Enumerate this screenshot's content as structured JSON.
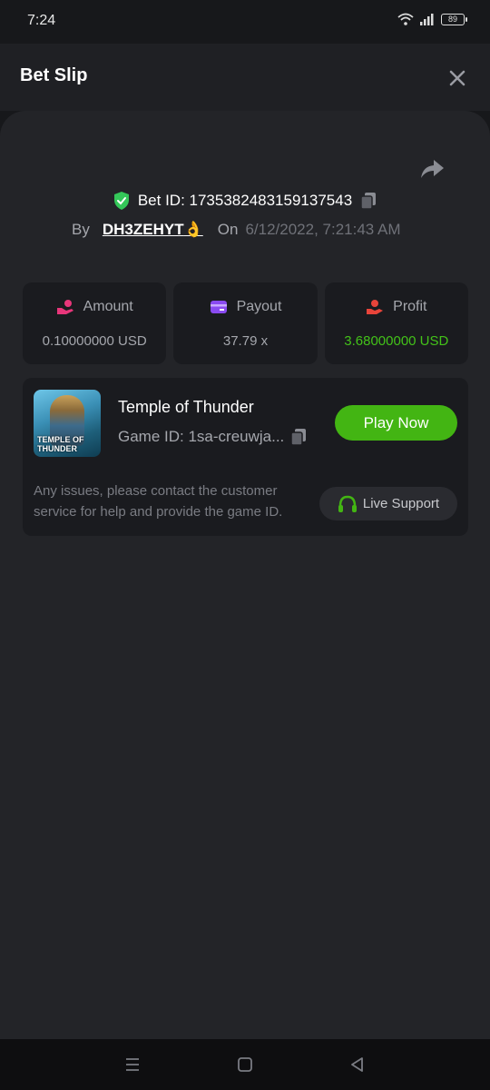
{
  "status": {
    "time": "7:24",
    "battery": "89"
  },
  "header": {
    "title": "Bet Slip"
  },
  "bet": {
    "id_label": "Bet ID: 1735382483159137543",
    "by_label": "By",
    "user": "DH3ZEHYT",
    "user_emoji": "👌",
    "on_label": "On",
    "date": "6/12/2022, 7:21:43 AM"
  },
  "stats": [
    {
      "label": "Amount",
      "value": "0.10000000 USD",
      "icon": "money-hand-icon",
      "color": "#e8367a"
    },
    {
      "label": "Payout",
      "value": "37.79 x",
      "icon": "wallet-card-icon",
      "color": "#8a4bf0"
    },
    {
      "label": "Profit",
      "value": "3.68000000 USD",
      "icon": "profit-hand-icon",
      "color": "#e8443a"
    }
  ],
  "game": {
    "thumb_text_1": "TEMPLE OF",
    "thumb_text_2": "THUNDER",
    "name": "Temple of Thunder",
    "id_label": "Game ID: 1sa-creuwja...",
    "play_label": "Play Now",
    "issue_text": "Any issues, please contact the customer service for help and provide the game ID.",
    "support_label": "Live Support"
  },
  "colors": {
    "accent_green": "#43b513",
    "profit_green": "#43c219",
    "shield_green": "#34c759"
  }
}
